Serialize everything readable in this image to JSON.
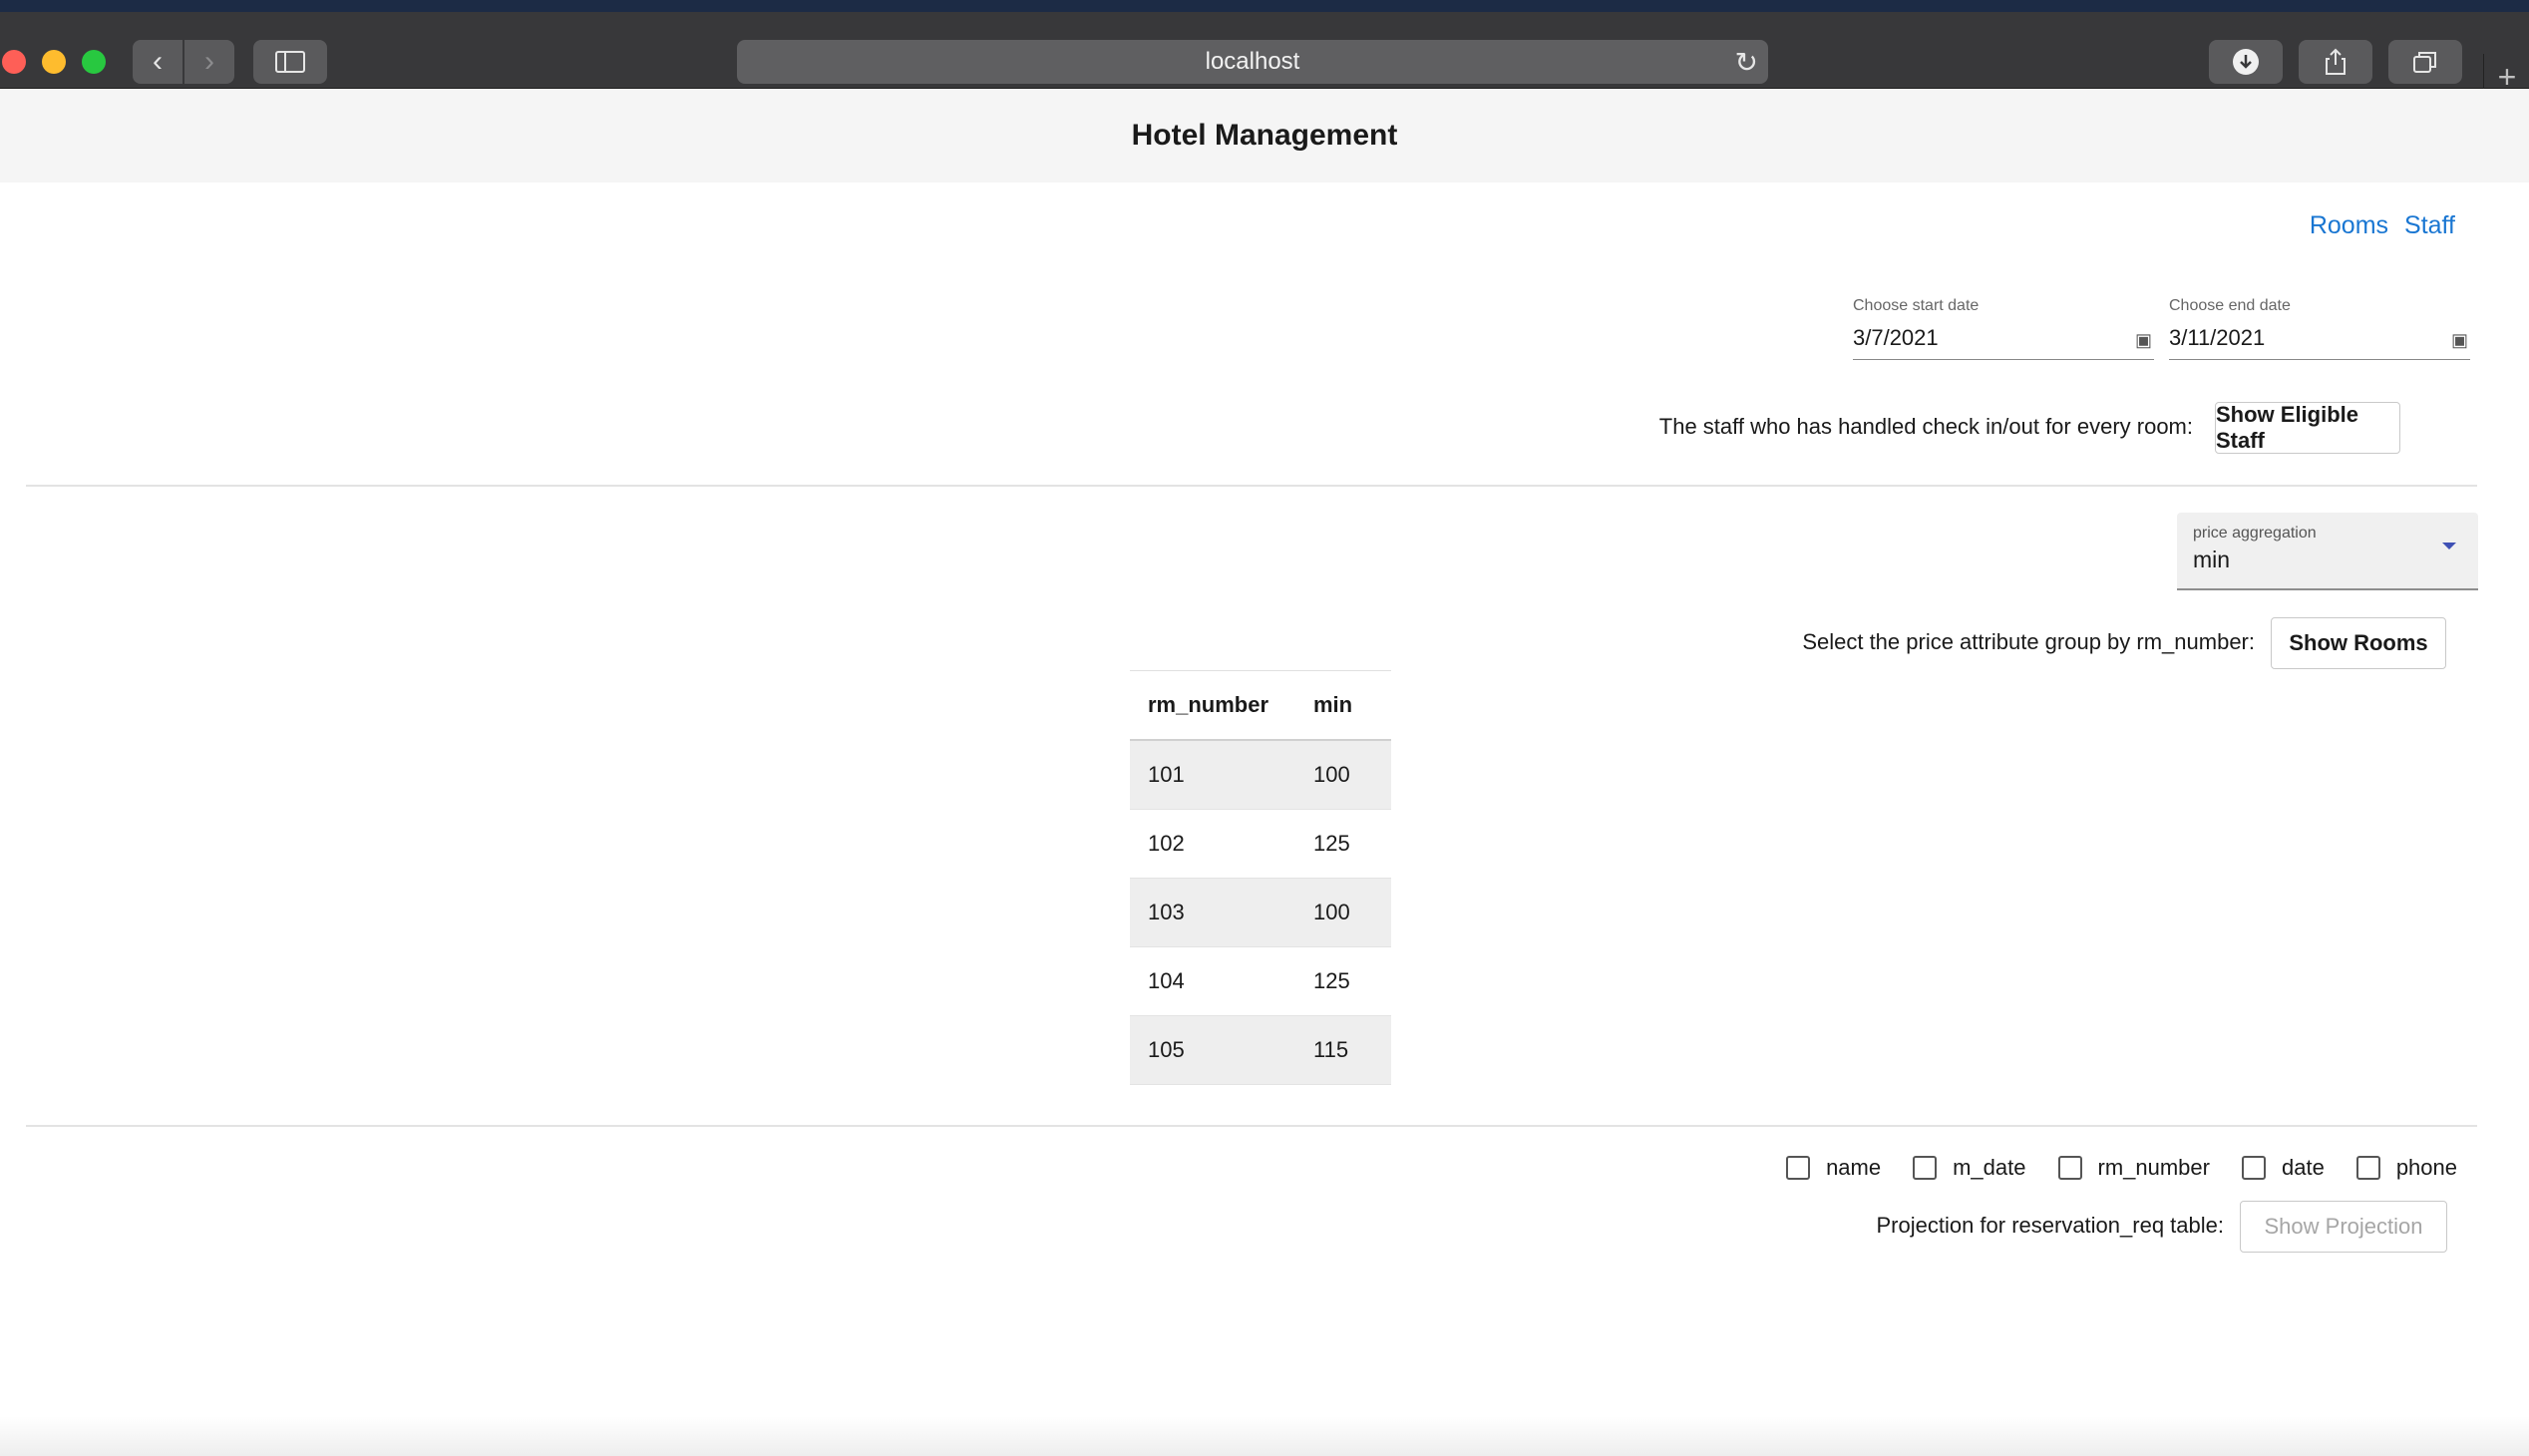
{
  "browser": {
    "url": "localhost",
    "icons": {
      "back": "chevron-left-icon",
      "forward": "chevron-right-icon",
      "sidebar": "sidebar-icon",
      "reload": "reload-icon",
      "download": "download-icon",
      "share": "share-icon",
      "tabs": "tabs-overview-icon",
      "new_tab": "plus-icon"
    }
  },
  "header": {
    "title": "Hotel Management"
  },
  "nav": {
    "rooms": "Rooms",
    "staff": "Staff"
  },
  "dates": {
    "start_label": "Choose start date",
    "start_value": "3/7/2021",
    "end_label": "Choose end date",
    "end_value": "3/11/2021"
  },
  "staff_section": {
    "text": "The staff who has handled check in/out for every room:",
    "button": "Show Eligible Staff"
  },
  "price_section": {
    "select_label": "price aggregation",
    "select_value": "min",
    "text": "Select the price attribute group by rm_number:",
    "button": "Show Rooms"
  },
  "table": {
    "columns": [
      "rm_number",
      "min"
    ],
    "rows": [
      [
        "101",
        "100"
      ],
      [
        "102",
        "125"
      ],
      [
        "103",
        "100"
      ],
      [
        "104",
        "125"
      ],
      [
        "105",
        "115"
      ]
    ]
  },
  "projection": {
    "checkboxes": [
      "name",
      "m_date",
      "rm_number",
      "date",
      "phone"
    ],
    "text": "Projection for reservation_req table:",
    "button": "Show Projection"
  },
  "colors": {
    "link": "#1976d2",
    "select_arrow": "#3f51b5"
  }
}
